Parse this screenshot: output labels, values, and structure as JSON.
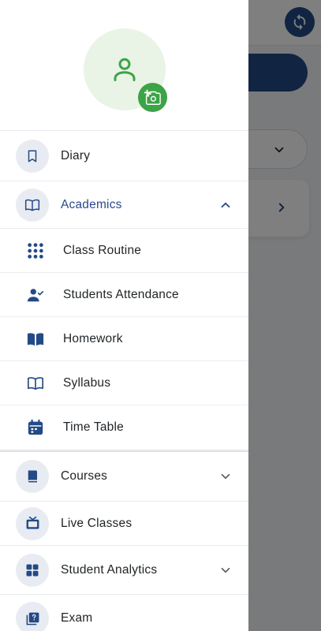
{
  "colors": {
    "accent": "#234a86",
    "active_text": "#2b4a8c",
    "avatar_bg": "#e9f4e6",
    "avatar_icon": "#3ca447",
    "camera_button": "#3ca447",
    "icon_circle_bg": "#e8ecf2",
    "scrim": "rgba(0,0,0,0.5)"
  },
  "profile": {
    "avatar_icon": "user-outline-icon",
    "camera_icon": "camera-add-icon"
  },
  "menu": {
    "diary": {
      "label": "Diary",
      "icon": "bookmark-icon"
    },
    "academics": {
      "label": "Academics",
      "icon": "open-book-icon",
      "expanded": true,
      "items": [
        {
          "label": "Class Routine",
          "icon": "grid-dots-icon"
        },
        {
          "label": "Students Attendance",
          "icon": "person-check-icon"
        },
        {
          "label": "Homework",
          "icon": "book-filled-icon"
        },
        {
          "label": "Syllabus",
          "icon": "open-book-icon"
        },
        {
          "label": "Time Table",
          "icon": "calendar-icon"
        }
      ]
    },
    "courses": {
      "label": "Courses",
      "icon": "book-icon"
    },
    "live_classes": {
      "label": "Live Classes",
      "icon": "tv-icon"
    },
    "student_analytics": {
      "label": "Student Analytics",
      "icon": "dashboard-grid-icon"
    },
    "exam": {
      "label": "Exam",
      "icon": "quiz-icon"
    }
  },
  "background": {
    "sync_icon": "sync-icon"
  }
}
